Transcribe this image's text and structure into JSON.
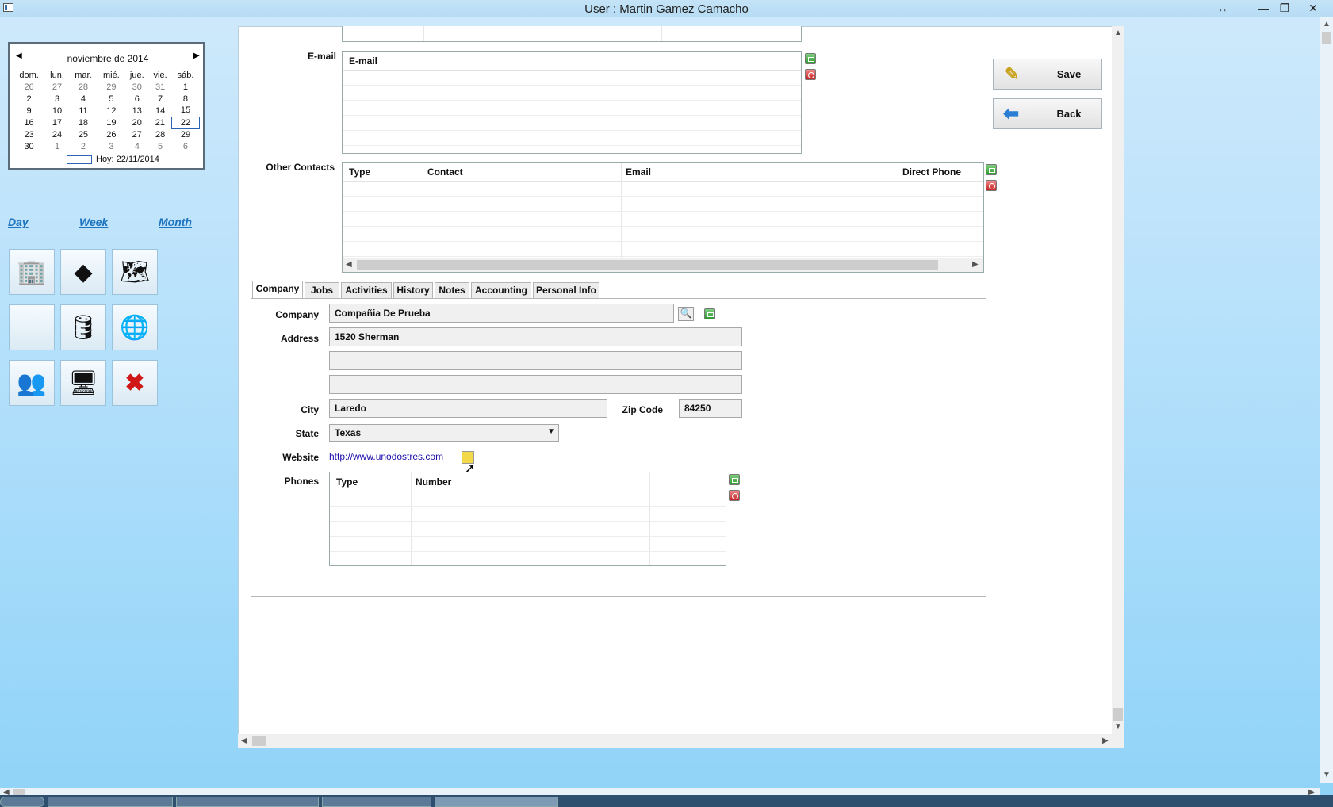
{
  "window": {
    "title": "User : Martin Gamez Camacho",
    "controls": [
      "↔",
      "—",
      "❐",
      "✕"
    ]
  },
  "calendar": {
    "month_label": "noviembre de 2014",
    "prev": "◀",
    "next": "▶",
    "weekdays": [
      "dom.",
      "lun.",
      "mar.",
      "mié.",
      "jue.",
      "vie.",
      "sáb."
    ],
    "weeks": [
      [
        "26",
        "27",
        "28",
        "29",
        "30",
        "31",
        "1"
      ],
      [
        "2",
        "3",
        "4",
        "5",
        "6",
        "7",
        "8"
      ],
      [
        "9",
        "10",
        "11",
        "12",
        "13",
        "14",
        "15"
      ],
      [
        "16",
        "17",
        "18",
        "19",
        "20",
        "21",
        "22"
      ],
      [
        "23",
        "24",
        "25",
        "26",
        "27",
        "28",
        "29"
      ],
      [
        "30",
        "1",
        "2",
        "3",
        "4",
        "5",
        "6"
      ]
    ],
    "selected": "22",
    "today_label": "Hoy: 22/11/2014"
  },
  "views": {
    "day": "Day",
    "week": "Week",
    "month": "Month"
  },
  "tiles": [
    "building-icon",
    "tool-icon",
    "map-icon",
    "blank-tile",
    "database-icon",
    "globe-download-icon",
    "contacts-icon",
    "server-icon",
    "close-app-icon"
  ],
  "email": {
    "label": "E-mail",
    "column": "E-mail"
  },
  "other_contacts": {
    "label": "Other Contacts",
    "columns": [
      "Type",
      "Contact",
      "Email",
      "Direct Phone"
    ]
  },
  "buttons": {
    "save": "Save",
    "back": "Back"
  },
  "tabs": [
    "Company",
    "Jobs",
    "Activities",
    "History",
    "Notes",
    "Accounting",
    "Personal Info"
  ],
  "form": {
    "company_label": "Company",
    "company_value": "Compañia De Prueba",
    "address_label": "Address",
    "address1": "1520 Sherman",
    "address2": "",
    "address3": "",
    "city_label": "City",
    "city_value": "Laredo",
    "zip_label": "Zip Code",
    "zip_value": "84250",
    "state_label": "State",
    "state_value": "Texas",
    "website_label": "Website",
    "website_value": "http://www.unodostres.com",
    "phones_label": "Phones",
    "phone_columns": [
      "Type",
      "Number"
    ]
  },
  "colors": {
    "accent": "#1e73be",
    "add": "#2c9a2c",
    "delete": "#c42424"
  }
}
